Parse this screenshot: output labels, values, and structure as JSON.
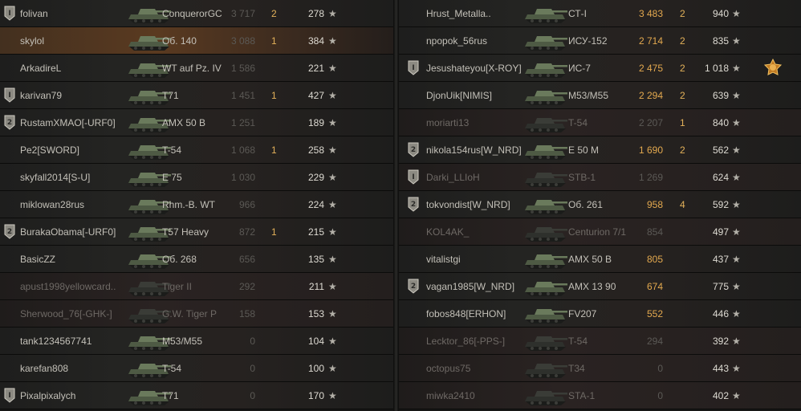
{
  "colors": {
    "player_row": "#5a3a20",
    "damage_highlight": "#e3a94f",
    "frags": "#e3b15a",
    "dimmed": "#6e6965",
    "text": "#c3c0b8"
  },
  "icons": {
    "rank_badge": "rank-badge-icon",
    "tank": "tank-icon",
    "xp": "star-icon",
    "medal": "medal-icon"
  },
  "left_team": [
    {
      "name": "folivan",
      "vehicle": "ConquerorGC",
      "damage": "3 717",
      "frags": "2",
      "xp": "278",
      "rank": "i",
      "dead": false,
      "player": false,
      "dmg_hot": false
    },
    {
      "name": "skylol",
      "vehicle": "Об. 140",
      "damage": "3 088",
      "frags": "1",
      "xp": "384",
      "rank": "",
      "dead": false,
      "player": true,
      "dmg_hot": false
    },
    {
      "name": "ArkadireL",
      "vehicle": "WT auf Pz. IV",
      "damage": "1 586",
      "frags": "",
      "xp": "221",
      "rank": "",
      "dead": false,
      "player": false,
      "dmg_hot": false
    },
    {
      "name": "karivan79",
      "vehicle": "T71",
      "damage": "1 451",
      "frags": "1",
      "xp": "427",
      "rank": "i",
      "dead": false,
      "player": false,
      "dmg_hot": false
    },
    {
      "name": "RustamXMAO[-URF0]",
      "vehicle": "AMX 50 B",
      "damage": "1 251",
      "frags": "",
      "xp": "189",
      "rank": "2",
      "dead": false,
      "player": false,
      "dmg_hot": false
    },
    {
      "name": "Pe2[SWORD]",
      "vehicle": "T-54",
      "damage": "1 068",
      "frags": "1",
      "xp": "258",
      "rank": "",
      "dead": false,
      "player": false,
      "dmg_hot": false
    },
    {
      "name": "skyfall2014[S-U]",
      "vehicle": "E 75",
      "damage": "1 030",
      "frags": "",
      "xp": "229",
      "rank": "",
      "dead": false,
      "player": false,
      "dmg_hot": false
    },
    {
      "name": "miklowan28rus",
      "vehicle": "Rhm.-B. WT",
      "damage": "966",
      "frags": "",
      "xp": "224",
      "rank": "",
      "dead": false,
      "player": false,
      "dmg_hot": false
    },
    {
      "name": "BurakaObama[-URF0]",
      "vehicle": "T57 Heavy",
      "damage": "872",
      "frags": "1",
      "xp": "215",
      "rank": "2",
      "dead": false,
      "player": false,
      "dmg_hot": false
    },
    {
      "name": "BasicZZ",
      "vehicle": "Об. 268",
      "damage": "656",
      "frags": "",
      "xp": "135",
      "rank": "",
      "dead": false,
      "player": false,
      "dmg_hot": false
    },
    {
      "name": "apust1998yellowcard..",
      "vehicle": "Tiger II",
      "damage": "292",
      "frags": "",
      "xp": "211",
      "rank": "",
      "dead": true,
      "player": false,
      "dmg_hot": false
    },
    {
      "name": "Sherwood_76[-GHK-]",
      "vehicle": "G.W. Tiger P",
      "damage": "158",
      "frags": "",
      "xp": "153",
      "rank": "",
      "dead": true,
      "player": false,
      "dmg_hot": false
    },
    {
      "name": "tank1234567741",
      "vehicle": "M53/M55",
      "damage": "0",
      "frags": "",
      "xp": "104",
      "rank": "",
      "dead": false,
      "player": false,
      "dmg_hot": false
    },
    {
      "name": "karefan808",
      "vehicle": "T-54",
      "damage": "0",
      "frags": "",
      "xp": "100",
      "rank": "",
      "dead": false,
      "player": false,
      "dmg_hot": false
    },
    {
      "name": "Pixalpixalych",
      "vehicle": "T71",
      "damage": "0",
      "frags": "",
      "xp": "170",
      "rank": "i",
      "dead": false,
      "player": false,
      "dmg_hot": false
    }
  ],
  "right_team": [
    {
      "name": "Hrust_Metalla..",
      "vehicle": "СТ-I",
      "damage": "3 483",
      "frags": "2",
      "xp": "940",
      "rank": "",
      "medal": "",
      "dead": false,
      "dmg_hot": true
    },
    {
      "name": "npopok_56rus",
      "vehicle": "ИСУ-152",
      "damage": "2 714",
      "frags": "2",
      "xp": "835",
      "rank": "",
      "medal": "",
      "dead": false,
      "dmg_hot": true
    },
    {
      "name": "Jesushateyou[X-ROY]",
      "vehicle": "ИС-7",
      "damage": "2 475",
      "frags": "2",
      "xp": "1 018",
      "rank": "i",
      "medal": "2",
      "dead": false,
      "dmg_hot": true
    },
    {
      "name": "DjonUik[NIMIS]",
      "vehicle": "M53/M55",
      "damage": "2 294",
      "frags": "2",
      "xp": "639",
      "rank": "",
      "medal": "",
      "dead": false,
      "dmg_hot": true
    },
    {
      "name": "moriarti13",
      "vehicle": "T-54",
      "damage": "2 207",
      "frags": "1",
      "xp": "840",
      "rank": "",
      "medal": "",
      "dead": true,
      "dmg_hot": false
    },
    {
      "name": "nikola154rus[W_NRD]",
      "vehicle": "E 50 M",
      "damage": "1 690",
      "frags": "2",
      "xp": "562",
      "rank": "2",
      "medal": "",
      "dead": false,
      "dmg_hot": true
    },
    {
      "name": "Darki_LLIoH",
      "vehicle": "STB-1",
      "damage": "1 269",
      "frags": "",
      "xp": "624",
      "rank": "i",
      "medal": "",
      "dead": true,
      "dmg_hot": false
    },
    {
      "name": "tokvondist[W_NRD]",
      "vehicle": "Об. 261",
      "damage": "958",
      "frags": "4",
      "xp": "592",
      "rank": "2",
      "medal": "",
      "dead": false,
      "dmg_hot": true
    },
    {
      "name": "KOL4AK_",
      "vehicle": "Centurion 7/1",
      "damage": "854",
      "frags": "",
      "xp": "497",
      "rank": "",
      "medal": "",
      "dead": true,
      "dmg_hot": false
    },
    {
      "name": "vitalistgi",
      "vehicle": "AMX 50 B",
      "damage": "805",
      "frags": "",
      "xp": "437",
      "rank": "",
      "medal": "",
      "dead": false,
      "dmg_hot": true
    },
    {
      "name": "vagan1985[W_NRD]",
      "vehicle": "AMX 13 90",
      "damage": "674",
      "frags": "",
      "xp": "775",
      "rank": "2",
      "medal": "",
      "dead": false,
      "dmg_hot": true
    },
    {
      "name": "fobos848[ERHON]",
      "vehicle": "FV207",
      "damage": "552",
      "frags": "",
      "xp": "446",
      "rank": "",
      "medal": "",
      "dead": false,
      "dmg_hot": true
    },
    {
      "name": "Lecktor_86[-PPS-]",
      "vehicle": "T-54",
      "damage": "294",
      "frags": "",
      "xp": "392",
      "rank": "",
      "medal": "",
      "dead": true,
      "dmg_hot": false
    },
    {
      "name": "octopus75",
      "vehicle": "T34",
      "damage": "0",
      "frags": "",
      "xp": "443",
      "rank": "",
      "medal": "",
      "dead": true,
      "dmg_hot": false
    },
    {
      "name": "miwka2410",
      "vehicle": "STA-1",
      "damage": "0",
      "frags": "",
      "xp": "402",
      "rank": "",
      "medal": "",
      "dead": true,
      "dmg_hot": false
    }
  ]
}
